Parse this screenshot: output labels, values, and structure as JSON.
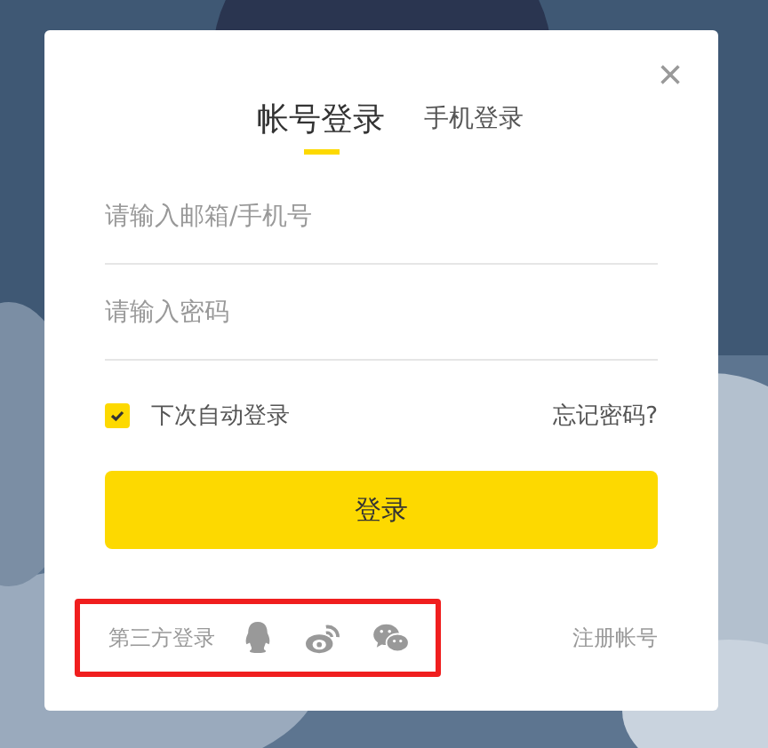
{
  "tabs": [
    {
      "label": "帐号登录",
      "selected": true
    },
    {
      "label": "手机登录",
      "selected": false
    }
  ],
  "close": "×",
  "fields": [
    {
      "placeholder": "请输入邮箱/手机号"
    },
    {
      "placeholder": "请输入密码"
    }
  ],
  "remember": {
    "label": "下次自动登录",
    "checked": true
  },
  "forgot": "忘记密码?",
  "submit": "登录",
  "third_party": {
    "label": "第三方登录",
    "highlighted": true,
    "icons": [
      {
        "kind": "qq"
      },
      {
        "kind": "weibo"
      },
      {
        "kind": "wechat"
      }
    ]
  },
  "register": "注册帐号"
}
